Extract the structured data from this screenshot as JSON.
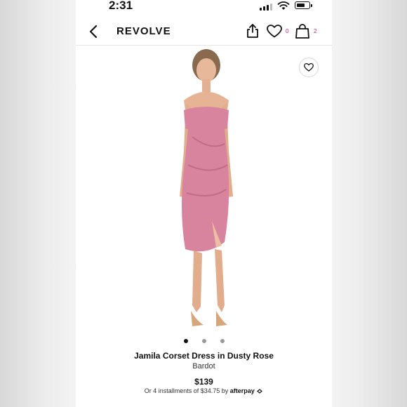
{
  "status_bar": {
    "time": "2:31"
  },
  "header": {
    "brand": "REVOLVE",
    "wishlist_count": "0",
    "bag_count": "2"
  },
  "product": {
    "name": "Jamila Corset Dress in Dusty Rose",
    "designer": "Bardot",
    "price": "$139",
    "installments_text": "Or 4 installments of $34.75 by",
    "installments_provider": "afterpay",
    "image_dots": 3,
    "active_dot": 0
  },
  "colors": {
    "dress": "#d9849e",
    "accent": "#c0297a"
  },
  "icons": [
    "back-arrow-icon",
    "share-icon",
    "heart-icon",
    "shopping-bag-icon",
    "wishlist-heart-icon",
    "afterpay-loop-icon",
    "cellular-signal-icon",
    "wifi-icon",
    "battery-icon"
  ]
}
